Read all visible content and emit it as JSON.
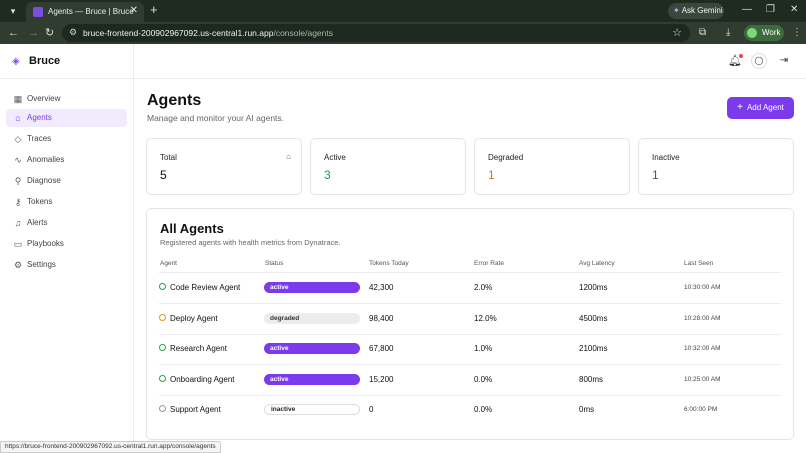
{
  "browser": {
    "tab_title": "Agents — Bruce | Bruce",
    "url_host": "bruce-frontend-200902967092.us-central1.run.app",
    "url_path": "/console/agents",
    "gemini_label": "Ask Gemini",
    "profile_label": "Work",
    "status_url": "https://bruce-frontend-200902967092.us-central1.run.app/console/agents"
  },
  "sidebar": {
    "brand": "Bruce",
    "items": [
      {
        "label": "Overview",
        "icon": "grid-icon"
      },
      {
        "label": "Agents",
        "icon": "bot-icon"
      },
      {
        "label": "Traces",
        "icon": "layers-icon"
      },
      {
        "label": "Anomalies",
        "icon": "activity-icon"
      },
      {
        "label": "Diagnose",
        "icon": "stethoscope-icon"
      },
      {
        "label": "Tokens",
        "icon": "key-icon"
      },
      {
        "label": "Alerts",
        "icon": "bell-icon"
      },
      {
        "label": "Playbooks",
        "icon": "book-icon"
      },
      {
        "label": "Settings",
        "icon": "gear-icon"
      }
    ]
  },
  "page": {
    "title": "Agents",
    "subtitle": "Manage and monitor your AI agents.",
    "add_button": "Add Agent"
  },
  "stats": [
    {
      "label": "Total",
      "value": "5",
      "color": "#111111"
    },
    {
      "label": "Active",
      "value": "3",
      "color": "#16a34a"
    },
    {
      "label": "Degraded",
      "value": "1",
      "color": "#d97706"
    },
    {
      "label": "Inactive",
      "value": "1",
      "color": "#4b5563"
    }
  ],
  "table": {
    "title": "All Agents",
    "subtitle": "Registered agents with health metrics from Dynatrace.",
    "headers": [
      "Agent",
      "Status",
      "Tokens Today",
      "Error Rate",
      "Avg Latency",
      "Last Seen"
    ],
    "rows": [
      {
        "name": "Code Review Agent",
        "status": "active",
        "tokens": "42,300",
        "error": "2.0%",
        "latency": "1200ms",
        "seen": "10:30:00 AM"
      },
      {
        "name": "Deploy Agent",
        "status": "degraded",
        "tokens": "98,400",
        "error": "12.0%",
        "latency": "4500ms",
        "seen": "10:28:00 AM"
      },
      {
        "name": "Research Agent",
        "status": "active",
        "tokens": "67,800",
        "error": "1.0%",
        "latency": "2100ms",
        "seen": "10:32:00 AM"
      },
      {
        "name": "Onboarding Agent",
        "status": "active",
        "tokens": "15,200",
        "error": "0.0%",
        "latency": "800ms",
        "seen": "10:25:00 AM"
      },
      {
        "name": "Support Agent",
        "status": "inactive",
        "tokens": "0",
        "error": "0.0%",
        "latency": "0ms",
        "seen": "6:00:00 PM"
      }
    ]
  },
  "colors": {
    "accent": "#7c3aed",
    "active": "#16a34a",
    "degraded": "#d97706"
  }
}
